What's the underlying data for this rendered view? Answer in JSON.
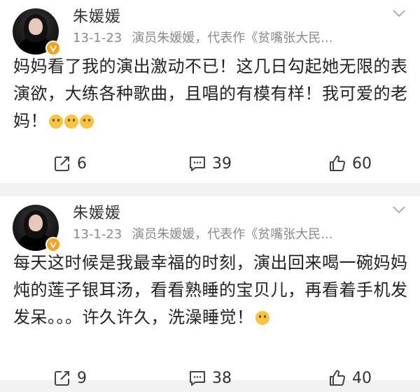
{
  "posts": [
    {
      "username": "朱媛媛",
      "date": "13-1-23",
      "source": "演员朱媛媛，代表作《贫嘴张大民...",
      "content": "妈妈看了我的演出激动不已！这几日勾起她无限的表演欲，大练各种歌曲，且唱的有模有样！我可爱的老妈！",
      "emojis": [
        "tongue-face-emoji",
        "smile-face-emoji",
        "cover-mouth-emoji"
      ],
      "reposts": "6",
      "comments": "39",
      "likes": "60"
    },
    {
      "username": "朱媛媛",
      "date": "13-1-23",
      "source": "演员朱媛媛，代表作《贫嘴张大民...",
      "content": "每天这时候是我最幸福的时刻，演出回来喝一碗妈妈炖的莲子银耳汤，看看熟睡的宝贝儿，再看着手机发发呆。。。许久许久，洗澡睡觉！",
      "emojis": [
        "yawn-face-emoji"
      ],
      "reposts": "9",
      "comments": "38",
      "likes": "40"
    }
  ],
  "colors": {
    "background": "#f2f2f2",
    "card": "#ffffff",
    "meta_text": "#8a8a8a",
    "verified_badge": "#f7a21b"
  }
}
